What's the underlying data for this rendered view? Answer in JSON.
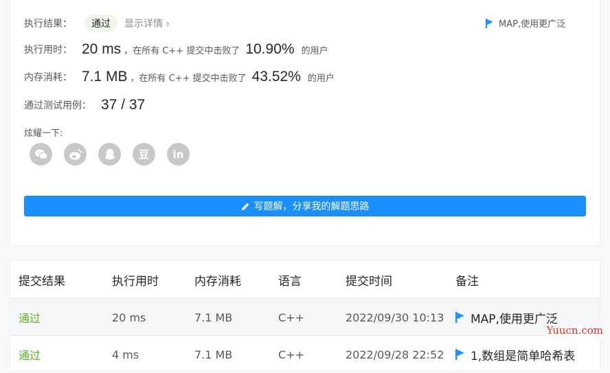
{
  "result": {
    "label": "执行结果：",
    "status": "通过",
    "details_link": "显示详情 ›",
    "note": "MAP,使用更广泛"
  },
  "runtime": {
    "label": "执行用时：",
    "value": "20 ms",
    "mid_text": "，在所有 C++ 提交中击败了",
    "percent": "10.90%",
    "suffix": "的用户"
  },
  "memory": {
    "label": "内存消耗：",
    "value": "7.1 MB",
    "mid_text": "，在所有 C++ 提交中击败了",
    "percent": "43.52%",
    "suffix": "的用户"
  },
  "testcases": {
    "label": "通过测试用例：",
    "value": "37 / 37"
  },
  "share": {
    "label": "炫耀一下:",
    "icons": [
      "wechat-icon",
      "weibo-icon",
      "qq-icon",
      "douban-icon",
      "linkedin-icon"
    ],
    "douban_glyph": "豆",
    "linkedin_glyph": "in"
  },
  "write_button": "写题解，分享我的解题思路",
  "table": {
    "headers": [
      "提交结果",
      "执行用时",
      "内存消耗",
      "语言",
      "提交时间",
      "备注"
    ],
    "rows": [
      [
        "通过",
        "20 ms",
        "7.1 MB",
        "C++",
        "2022/09/30 10:13",
        "MAP,使用更广泛"
      ],
      [
        "通过",
        "4 ms",
        "7.1 MB",
        "C++",
        "2022/09/28 22:52",
        "1,数组是简单哈希表"
      ]
    ]
  },
  "watermark": "Yuucn.com",
  "colors": {
    "accent": "#1a90ff",
    "pass_green": "#5fb02b",
    "icon_gray": "#c8c8c8"
  }
}
